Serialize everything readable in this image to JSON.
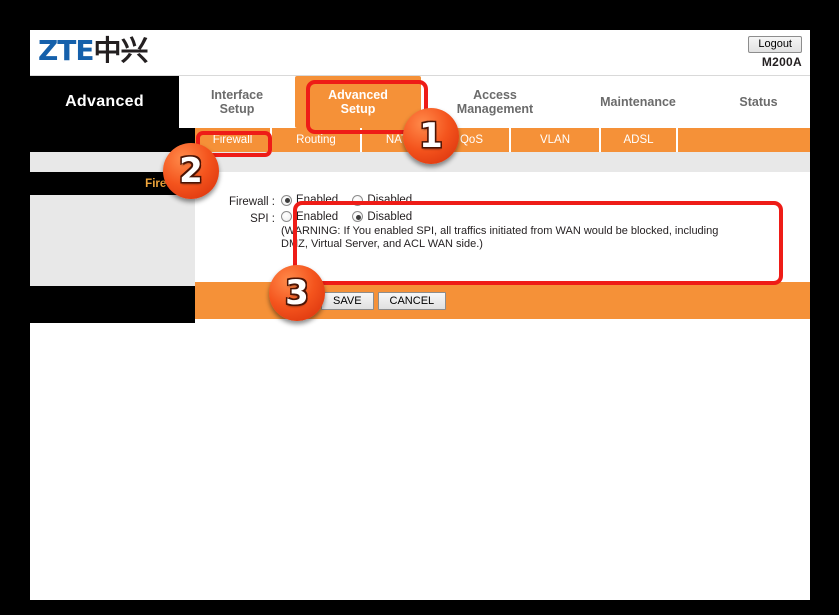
{
  "header": {
    "logo_latin": "ZTE",
    "logo_cjk": "中兴",
    "logout_label": "Logout",
    "model": "M200A"
  },
  "section": {
    "title": "Advanced"
  },
  "main_tabs": [
    {
      "label": "Interface\nSetup",
      "active": false
    },
    {
      "label": "Advanced\nSetup",
      "active": true
    },
    {
      "label": "Access\nManagement",
      "active": false
    },
    {
      "label": "Maintenance",
      "active": false
    },
    {
      "label": "Status",
      "active": false
    }
  ],
  "sub_tabs": [
    {
      "label": "Firewall",
      "active": true
    },
    {
      "label": "Routing",
      "active": false
    },
    {
      "label": "NAT",
      "active": false
    },
    {
      "label": "QoS",
      "active": false
    },
    {
      "label": "VLAN",
      "active": false
    },
    {
      "label": "ADSL",
      "active": false
    }
  ],
  "sidebar": {
    "heading": "Firewall"
  },
  "form": {
    "firewall_label": "Firewall :",
    "spi_label": "SPI :",
    "enabled_label": "Enabled",
    "disabled_label": "Disabled",
    "firewall_value": "Enabled",
    "spi_value": "Disabled",
    "warning_line1": "(WARNING: If You enabled SPI, all traffics initiated from WAN would be blocked, including",
    "warning_line2": "DMZ, Virtual Server, and ACL WAN side.)"
  },
  "toolbar": {
    "save_label": "SAVE",
    "cancel_label": "CANCEL"
  },
  "annotations": {
    "badge1": "1",
    "badge2": "2",
    "badge3": "3"
  },
  "colors": {
    "orange": "#f59138",
    "highlight_red": "#ee1c17",
    "logo_blue": "#1560ab",
    "sidebar_gray": "#e8e8e8",
    "sidebar_heading": "#f0a63c"
  }
}
